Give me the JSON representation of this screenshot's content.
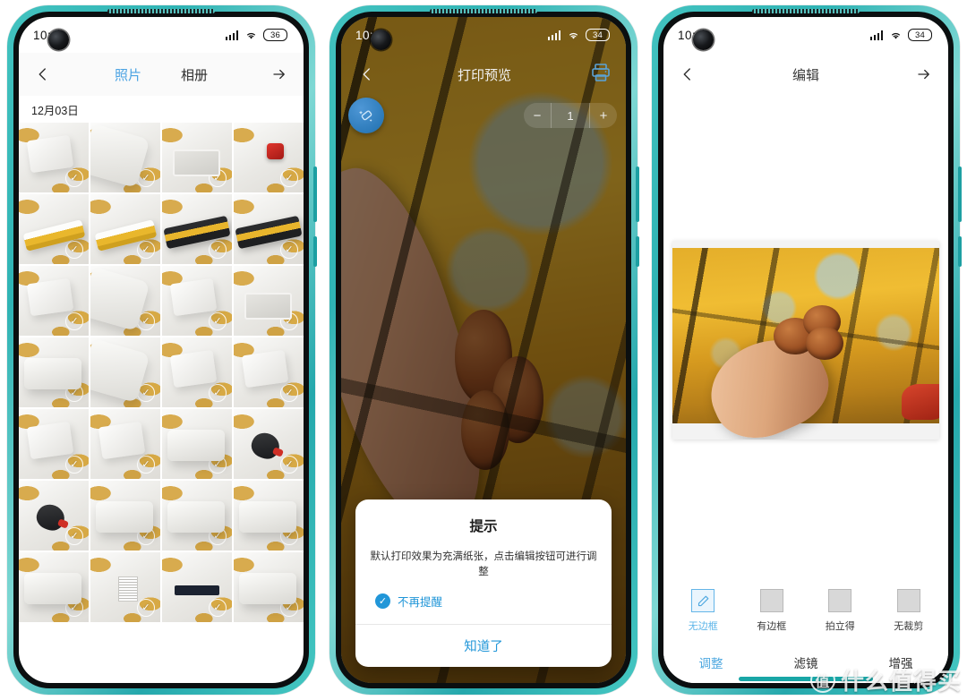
{
  "phones": [
    {
      "id": "gallery",
      "status": {
        "time": "10:06",
        "signal_icon": "signal-icon",
        "wifi_icon": "wifi-icon",
        "battery": "36"
      },
      "nav": {
        "back_icon": "chevron-left-icon",
        "forward_icon": "arrow-right-icon",
        "tabs": [
          {
            "label": "照片",
            "active": true
          },
          {
            "label": "相册",
            "active": false
          }
        ]
      },
      "date_header": "12月03日",
      "check_icon": "check-icon",
      "grid": [
        [
          "box",
          "slab",
          "tray",
          "redbtn"
        ],
        [
          "cart-y",
          "cart-y",
          "cart-d",
          "cart-d"
        ],
        [
          "box",
          "slab",
          "box",
          "tray"
        ],
        [
          "printer",
          "slab",
          "box",
          "box"
        ],
        [
          "box",
          "box",
          "printer",
          "mouse"
        ],
        [
          "mouse",
          "printer",
          "printer",
          "printer"
        ],
        [
          "printer",
          "label",
          "printer-f",
          "printer"
        ]
      ]
    },
    {
      "id": "print-preview",
      "status": {
        "time": "10:05",
        "signal_icon": "signal-icon",
        "wifi_icon": "wifi-icon",
        "battery": "34"
      },
      "topbar": {
        "back_icon": "chevron-left-icon",
        "title": "打印预览",
        "printer_icon": "printer-icon"
      },
      "toolrow": {
        "magic_icon": "magic-wand-icon",
        "stepper": {
          "minus": "−",
          "value": "1",
          "plus": "+"
        }
      },
      "dialog": {
        "title": "提示",
        "message": "默认打印效果为充满纸张，点击编辑按钮可进行调整",
        "checkbox_label": "不再提醒",
        "checkbox_checked": true,
        "check_icon": "check-icon",
        "confirm_label": "知道了"
      }
    },
    {
      "id": "edit",
      "status": {
        "time": "10:06",
        "signal_icon": "signal-icon",
        "wifi_icon": "wifi-icon",
        "battery": "34"
      },
      "nav": {
        "back_icon": "chevron-left-icon",
        "title": "编辑",
        "forward_icon": "arrow-right-icon"
      },
      "options": [
        {
          "label": "无边框",
          "icon": "pencil-icon",
          "active": true
        },
        {
          "label": "有边框",
          "icon": "square-icon",
          "active": false
        },
        {
          "label": "拍立得",
          "icon": "square-icon",
          "active": false
        },
        {
          "label": "无裁剪",
          "icon": "square-icon",
          "active": false
        }
      ],
      "modes": [
        {
          "label": "调整",
          "active": true
        },
        {
          "label": "滤镜",
          "active": false
        },
        {
          "label": "增强",
          "active": false
        }
      ]
    }
  ],
  "watermark": {
    "badge": "值",
    "text": "什么值得买"
  },
  "colors": {
    "accent": "#4ea8e0",
    "frame": "#3cc0bd",
    "dialog_action": "#2196d8"
  }
}
